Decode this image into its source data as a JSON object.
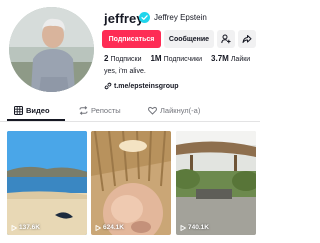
{
  "profile": {
    "username": "jeffrey",
    "nickname": "Jeffrey Epstein",
    "verified": true,
    "bio": "yes, i'm alive.",
    "link": "t.me/epsteinsgroup"
  },
  "buttons": {
    "follow": "Подписаться",
    "message": "Сообщение"
  },
  "stats": {
    "following_value": "2",
    "following_label": "Подписки",
    "followers_value": "1M",
    "followers_label": "Подписчики",
    "likes_value": "3.7M",
    "likes_label": "Лайки"
  },
  "tabs": [
    {
      "label": "Видео",
      "icon": "grid-icon",
      "active": true
    },
    {
      "label": "Репосты",
      "icon": "repost-icon",
      "active": false
    },
    {
      "label": "Лайкнул(-а)",
      "icon": "heart-icon",
      "active": false
    }
  ],
  "videos": [
    {
      "views": "137.6K"
    },
    {
      "views": "624.1K"
    },
    {
      "views": "740.1K"
    }
  ],
  "colors": {
    "accent": "#fe2c55",
    "verified": "#20d5ec",
    "text": "#161823"
  }
}
